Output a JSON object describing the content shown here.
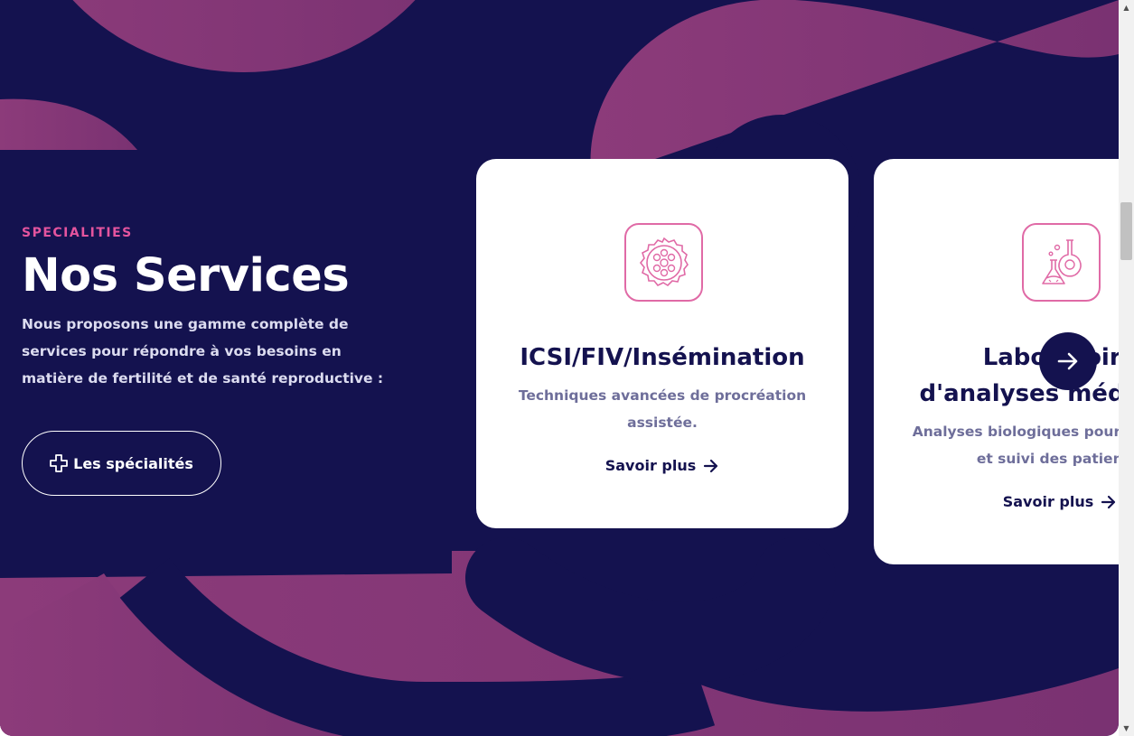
{
  "section": {
    "eyebrow": "SPECIALITIES",
    "title": "Nos Services",
    "description": "Nous proposons une gamme complète de services pour répondre à vos besoins en matière de fertilité et de santé reproductive :",
    "cta_label": "Les spécialités"
  },
  "cards": [
    {
      "icon": "embryo-cell-icon",
      "title": "ICSI/FIV/Insémination",
      "description": "Techniques avancées de procréation assistée.",
      "link_label": "Savoir plus"
    },
    {
      "icon": "lab-flask-icon",
      "title": "Laboratoire d'analyses médicales",
      "description": "Analyses biologiques pour diagnostic et suivi des patients.",
      "link_label": "Savoir plus"
    }
  ],
  "carousel": {
    "next_icon": "arrow-right-icon"
  },
  "colors": {
    "background": "#14124f",
    "accent": "#e4549e",
    "shape_start": "#8a3a78",
    "shape_end": "#7a3272",
    "card": "#ffffff"
  }
}
